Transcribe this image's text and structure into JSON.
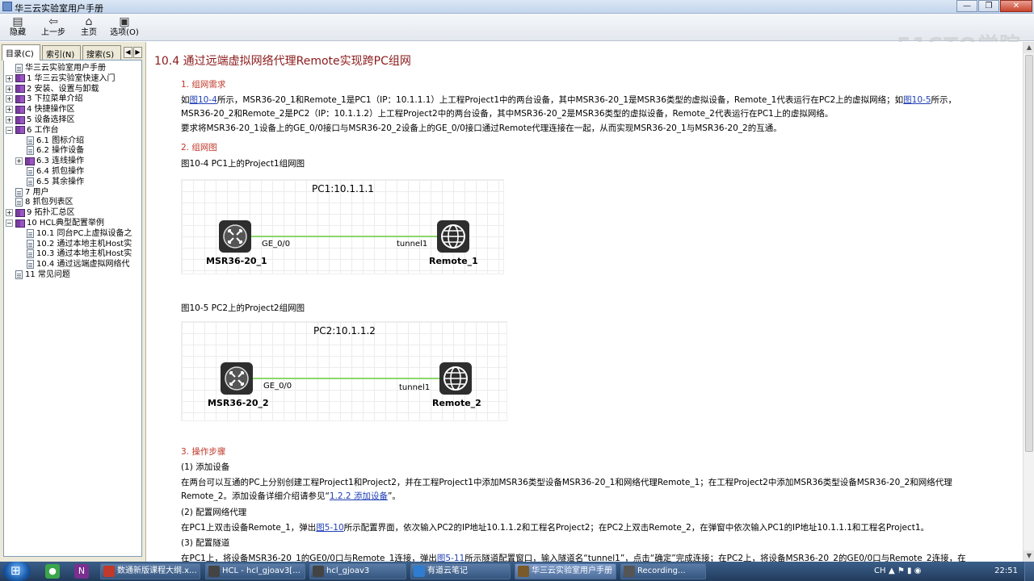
{
  "window": {
    "title": "华三云实验室用户手册",
    "controls": [
      "—",
      "❐",
      "✕"
    ]
  },
  "toolbar": {
    "hide": "隐藏",
    "back": "上一步",
    "home": "主页",
    "options": "选项(O)"
  },
  "watermark": "51CTO学院",
  "left_tabs": {
    "contents": "目录(C)",
    "index": "索引(N)",
    "search": "搜索(S)"
  },
  "tree": [
    {
      "label": "华三云实验室用户手册",
      "kind": "page",
      "level": 0,
      "expander": ""
    },
    {
      "label": "1 华三云实验室快速入门",
      "kind": "book",
      "level": 0,
      "expander": "+"
    },
    {
      "label": "2 安装、设置与卸载",
      "kind": "book",
      "level": 0,
      "expander": "+"
    },
    {
      "label": "3 下拉菜单介绍",
      "kind": "book",
      "level": 0,
      "expander": "+"
    },
    {
      "label": "4 快捷操作区",
      "kind": "book",
      "level": 0,
      "expander": "+"
    },
    {
      "label": "5 设备选择区",
      "kind": "book",
      "level": 0,
      "expander": "+"
    },
    {
      "label": "6 工作台",
      "kind": "book",
      "level": 0,
      "expander": "−"
    },
    {
      "label": "6.1 图标介绍",
      "kind": "page",
      "level": 2,
      "expander": ""
    },
    {
      "label": "6.2 操作设备",
      "kind": "page",
      "level": 2,
      "expander": ""
    },
    {
      "label": "6.3 连线操作",
      "kind": "book",
      "level": 1,
      "expander": "+"
    },
    {
      "label": "6.4 抓包操作",
      "kind": "page",
      "level": 2,
      "expander": ""
    },
    {
      "label": "6.5 其余操作",
      "kind": "page",
      "level": 2,
      "expander": ""
    },
    {
      "label": "7 用户",
      "kind": "page",
      "level": 0,
      "expander": ""
    },
    {
      "label": "8 抓包列表区",
      "kind": "page",
      "level": 0,
      "expander": ""
    },
    {
      "label": "9 拓扑汇总区",
      "kind": "book",
      "level": 0,
      "expander": "+"
    },
    {
      "label": "10 HCL典型配置举例",
      "kind": "book",
      "level": 0,
      "expander": "−"
    },
    {
      "label": "10.1 同台PC上虚拟设备之",
      "kind": "page",
      "level": 2,
      "expander": ""
    },
    {
      "label": "10.2 通过本地主机Host实",
      "kind": "page",
      "level": 2,
      "expander": ""
    },
    {
      "label": "10.3 通过本地主机Host实",
      "kind": "page",
      "level": 2,
      "expander": ""
    },
    {
      "label": "10.4 通过远端虚拟网络代",
      "kind": "page",
      "level": 2,
      "expander": ""
    },
    {
      "label": "11 常见问题",
      "kind": "page",
      "level": 0,
      "expander": ""
    }
  ],
  "content": {
    "heading": "10.4  通过远端虚拟网络代理Remote实现跨PC组网",
    "sec1": "1. 组网需求",
    "p1a_pre": "如",
    "p1a_link1": "图10-4",
    "p1a_mid": "所示，MSR36-20_1和Remote_1是PC1（IP：10.1.1.1）上工程Project1中的两台设备，其中MSR36-20_1是MSR36类型的虚拟设备，Remote_1代表运行在PC2上的虚拟网络；如",
    "p1a_link2": "图10-5",
    "p1a_post": "所示，",
    "p1b": "MSR36-20_2和Remote_2是PC2（IP：10.1.1.2）上工程Project2中的两台设备，其中MSR36-20_2是MSR36类型的虚拟设备，Remote_2代表运行在PC1上的虚拟网络。",
    "p1c": "要求将MSR36-20_1设备上的GE_0/0接口与MSR36-20_2设备上的GE_0/0接口通过Remote代理连接在一起，从而实现MSR36-20_1与MSR36-20_2的互通。",
    "sec2": "2. 组网图",
    "fig1_caption": "图10-4 PC1上的Project1组网图",
    "fig1": {
      "pc": "PC1:10.1.1.1",
      "left": "MSR36-20_1",
      "right": "Remote_1",
      "lport": "GE_0/0",
      "rport": "tunnel1"
    },
    "fig2_caption": "图10-5 PC2上的Project2组网图",
    "fig2": {
      "pc": "PC2:10.1.1.2",
      "left": "MSR36-20_2",
      "right": "Remote_2",
      "lport": "GE_0/0",
      "rport": "tunnel1"
    },
    "sec3": "3. 操作步骤",
    "step1": "(1)   添加设备",
    "step1a": "在两台可以互通的PC上分别创建工程Project1和Project2，并在工程Project1中添加MSR36类型设备MSR36-20_1和网络代理Remote_1；在工程Project2中添加MSR36类型设备MSR36-20_2和网络代理",
    "step1b_pre": "Remote_2。添加设备详细介绍请参见“",
    "step1b_link": "1.2.2  添加设备",
    "step1b_post": "”。",
    "step2": "(2)   配置网络代理",
    "step2a_pre": "在PC1上双击设备Remote_1，弹出",
    "step2a_link": "图5-10",
    "step2a_post": "所示配置界面，依次输入PC2的IP地址10.1.1.2和工程名Project2；在PC2上双击Remote_2，在弹窗中依次输入PC1的IP地址10.1.1.1和工程名Project1。",
    "step3": "(3)   配置隧道",
    "step3a_pre": "在PC1上，将设备MSR36-20_1的GE0/0口与Remote_1连接，弹出",
    "step3a_link": "图5-11",
    "step3a_post": "所示隧道配置窗口，输入隧道名“tunnel1”，点击“确定”完成连接；在PC2上，将设备MSR36-20_2的GE0/0口与Remote_2连接，在"
  },
  "taskbar": {
    "tasks": [
      {
        "label": "数通新版课程大纲.x...",
        "color": "#c0392b"
      },
      {
        "label": "HCL - hcl_gjoav3[...",
        "color": "#444"
      },
      {
        "label": "hcl_gjoav3",
        "color": "#444"
      },
      {
        "label": "有道云笔记",
        "color": "#2e7dd1"
      },
      {
        "label": "华三云实验室用户手册",
        "color": "#7a5a2a"
      },
      {
        "label": "Recording...",
        "color": "#555"
      }
    ],
    "lang": "CH",
    "time": "22:51"
  }
}
